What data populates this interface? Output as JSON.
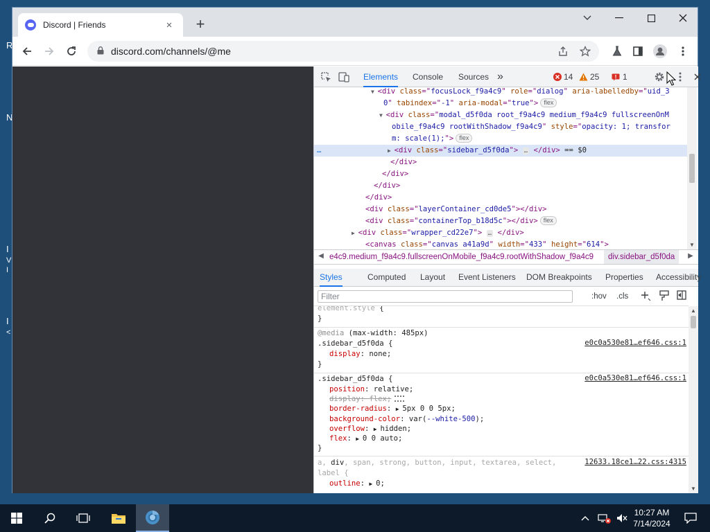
{
  "desktop": {
    "edge_chars": [
      {
        "char": "R"
      },
      {
        "char": "N"
      },
      {
        "char": "I"
      },
      {
        "char": "V"
      },
      {
        "char": "I"
      },
      {
        "char": "I"
      },
      {
        "char": "<"
      }
    ]
  },
  "browser": {
    "tab_title": "Discord | Friends",
    "tab_close": "×",
    "new_tab": "+",
    "url": "discord.com/channels/@me"
  },
  "devtools": {
    "tabs": [
      "Elements",
      "Console",
      "Sources"
    ],
    "more_tabs": "»",
    "errors": "14",
    "warnings": "25",
    "issues": "1",
    "dom_lines": [
      {
        "indent": 92,
        "tri": "▼",
        "html": [
          [
            "tag",
            "<div "
          ],
          [
            "an",
            "class"
          ],
          [
            "tag",
            "=\""
          ],
          [
            "av",
            "focusLock_f9a4c9"
          ],
          [
            "tag",
            "\" "
          ],
          [
            "an",
            "role"
          ],
          [
            "tag",
            "=\""
          ],
          [
            "av",
            "dialog"
          ],
          [
            "tag",
            "\" "
          ],
          [
            "an",
            "aria-labelledby"
          ],
          [
            "tag",
            "=\""
          ],
          [
            "av",
            "uid_3"
          ]
        ]
      },
      {
        "indent": 100,
        "tri": "",
        "html": [
          [
            "av",
            "0"
          ],
          [
            "tag",
            "\" "
          ],
          [
            "an",
            "tabindex"
          ],
          [
            "tag",
            "=\""
          ],
          [
            "av",
            "-1"
          ],
          [
            "tag",
            "\" "
          ],
          [
            "an",
            "aria-modal"
          ],
          [
            "tag",
            "=\""
          ],
          [
            "av",
            "true"
          ],
          [
            "tag",
            "\">"
          ]
        ],
        "flex": true
      },
      {
        "indent": 104,
        "tri": "▼",
        "html": [
          [
            "tag",
            "<div "
          ],
          [
            "an",
            "class"
          ],
          [
            "tag",
            "=\""
          ],
          [
            "av",
            "modal_d5f0da root_f9a4c9 medium_f9a4c9 fullscreenOnM"
          ]
        ]
      },
      {
        "indent": 112,
        "tri": "",
        "html": [
          [
            "av",
            "obile_f9a4c9 rootWithShadow_f9a4c9"
          ],
          [
            "tag",
            "\" "
          ],
          [
            "an",
            "style"
          ],
          [
            "tag",
            "=\""
          ],
          [
            "av",
            "opacity: 1; transfor"
          ]
        ]
      },
      {
        "indent": 112,
        "tri": "",
        "html": [
          [
            "av",
            "m: scale(1);"
          ],
          [
            "tag",
            "\">"
          ]
        ],
        "flex": true
      },
      {
        "indent": 116,
        "tri": "▶",
        "html": [
          [
            "tag",
            "<div "
          ],
          [
            "an",
            "class"
          ],
          [
            "tag",
            "=\""
          ],
          [
            "av",
            "sidebar_d5f0da"
          ],
          [
            "tag",
            "\">"
          ]
        ],
        "dots": true,
        "after": [
          [
            "tag",
            "</div>"
          ],
          [
            "pl",
            " == $0"
          ]
        ],
        "selected": true
      },
      {
        "indent": 110,
        "tri": "",
        "html": [
          [
            "tag",
            "</div>"
          ]
        ]
      },
      {
        "indent": 98,
        "tri": "",
        "html": [
          [
            "tag",
            "</div>"
          ]
        ]
      },
      {
        "indent": 86,
        "tri": "",
        "html": [
          [
            "tag",
            "</div>"
          ]
        ]
      },
      {
        "indent": 74,
        "tri": "",
        "html": [
          [
            "tag",
            "</div>"
          ]
        ]
      },
      {
        "indent": 74,
        "tri": "",
        "html": [
          [
            "tag",
            "<div "
          ],
          [
            "an",
            "class"
          ],
          [
            "tag",
            "=\""
          ],
          [
            "av",
            "layerContainer_cd0de5"
          ],
          [
            "tag",
            "\"></div>"
          ]
        ]
      },
      {
        "indent": 74,
        "tri": "",
        "html": [
          [
            "tag",
            "<div "
          ],
          [
            "an",
            "class"
          ],
          [
            "tag",
            "=\""
          ],
          [
            "av",
            "containerTop_b18d5c"
          ],
          [
            "tag",
            "\"></div>"
          ]
        ],
        "flex": true
      },
      {
        "indent": 64,
        "tri": "▶",
        "html": [
          [
            "tag",
            "<div "
          ],
          [
            "an",
            "class"
          ],
          [
            "tag",
            "=\""
          ],
          [
            "av",
            "wrapper_cd22e7"
          ],
          [
            "tag",
            "\">"
          ]
        ],
        "dots": true,
        "after": [
          [
            "tag",
            "</div>"
          ]
        ]
      },
      {
        "indent": 74,
        "tri": "",
        "html": [
          [
            "tag",
            "<canvas "
          ],
          [
            "an",
            "class"
          ],
          [
            "tag",
            "=\""
          ],
          [
            "av",
            "canvas a41a9d"
          ],
          [
            "tag",
            "\" "
          ],
          [
            "an",
            "width"
          ],
          [
            "tag",
            "=\""
          ],
          [
            "av",
            "433"
          ],
          [
            "tag",
            "\" "
          ],
          [
            "an",
            "height"
          ],
          [
            "tag",
            "=\""
          ],
          [
            "av",
            "614"
          ],
          [
            "tag",
            "\">"
          ]
        ]
      }
    ],
    "flex_badge": "flex",
    "breadcrumb_prev": "e4c9.medium_f9a4c9.fullscreenOnMobile_f9a4c9.rootWithShadow_f9a4c9",
    "breadcrumb_current": "div.sidebar_d5f0da",
    "subtabs": [
      "Styles",
      "Computed",
      "Layout",
      "Event Listeners",
      "DOM Breakpoints",
      "Properties",
      "Accessibility"
    ],
    "filter_placeholder": "Filter",
    "hov": ":hov",
    "cls": ".cls",
    "styles": {
      "element_style": "element.style {",
      "close_brace": "}",
      "media_label": "@media",
      "media_query": " (max-width: 485px)",
      "rule1_selector": ".sidebar_d5f0da {",
      "rule1_source": "e0c0a530e81…ef646.css:1",
      "rule1_props": [
        {
          "name": "display",
          "value": "none;"
        }
      ],
      "rule2_selector": ".sidebar_d5f0da {",
      "rule2_source": "e0c0a530e81…ef646.css:1",
      "rule2_props": [
        {
          "name": "position",
          "value": "relative;"
        },
        {
          "name": "display",
          "value": "flex;",
          "struck": true
        },
        {
          "name": "border-radius",
          "value": "5px 0 0 5px;",
          "tri": true
        },
        {
          "name": "background-color",
          "value": "var(--white-500);"
        },
        {
          "name": "overflow",
          "value": "hidden;",
          "tri": true
        },
        {
          "name": "flex",
          "value": "0 0 auto;",
          "tri": true
        }
      ],
      "rule3_selector_a": "a, ",
      "rule3_selector_div": "div",
      "rule3_selector_b": ", span, strong, button, input, textarea, select,",
      "rule3_selector_c": "label {",
      "rule3_source": "12633.18ce1…22.css:4315",
      "rule3_props": [
        {
          "name": "outline",
          "value": "0;",
          "tri": true
        }
      ]
    }
  },
  "taskbar": {
    "time": "10:27 AM",
    "date": "7/14/2024"
  }
}
